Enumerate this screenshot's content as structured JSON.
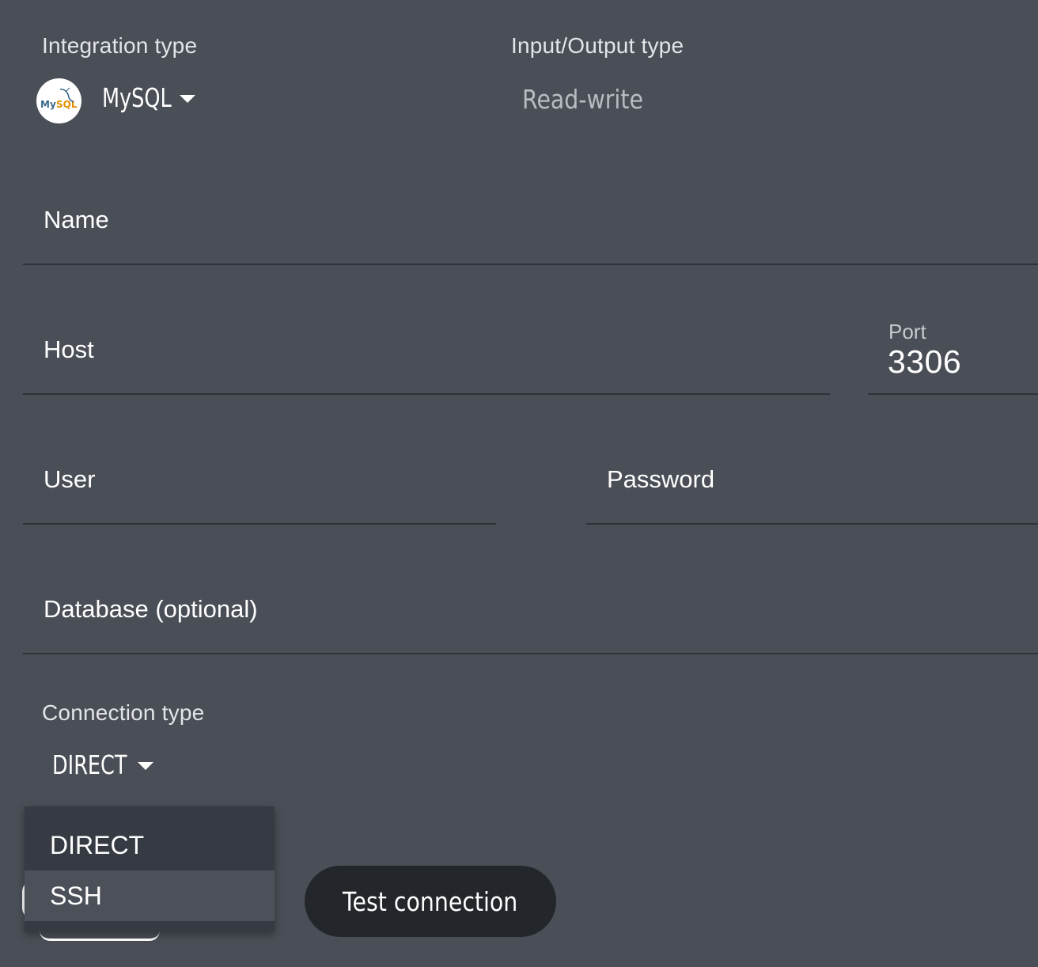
{
  "header": {
    "integration_type_label": "Integration type",
    "integration_type_value": "MySQL",
    "io_type_label": "Input/Output type",
    "io_type_value": "Read-write",
    "logo_icon": "mysql-logo-icon"
  },
  "form": {
    "name_label": "Name",
    "host_label": "Host",
    "port_label": "Port",
    "port_value": "3306",
    "user_label": "User",
    "password_label": "Password",
    "database_label": "Database (optional)"
  },
  "connection": {
    "label": "Connection type",
    "selected": "DIRECT",
    "options": [
      "DIRECT",
      "SSH"
    ]
  },
  "actions": {
    "test_connection_label": "Test connection"
  }
}
